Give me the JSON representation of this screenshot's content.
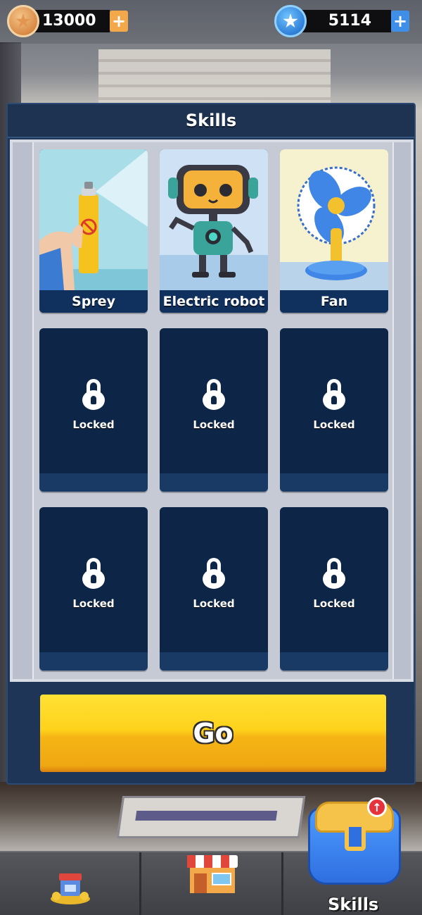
{
  "currencies": {
    "coins": {
      "icon": "coin-star-icon",
      "amount": "13000",
      "plus": "+"
    },
    "gems": {
      "icon": "blue-star-gem-icon",
      "amount": "5114",
      "plus": "+"
    }
  },
  "panel": {
    "title": "Skills",
    "skills": [
      {
        "name": "Sprey",
        "state": "unlocked",
        "art": "spray-can-icon"
      },
      {
        "name": "Electric robot",
        "state": "unlocked",
        "art": "robot-icon"
      },
      {
        "name": "Fan",
        "state": "unlocked",
        "art": "fan-icon"
      },
      {
        "label": "Locked",
        "state": "locked"
      },
      {
        "label": "Locked",
        "state": "locked"
      },
      {
        "label": "Locked",
        "state": "locked"
      },
      {
        "label": "Locked",
        "state": "locked"
      },
      {
        "label": "Locked",
        "state": "locked"
      },
      {
        "label": "Locked",
        "state": "locked"
      }
    ],
    "go_label": "Go"
  },
  "bottom_nav": {
    "tabs": [
      {
        "icon": "gift-shop-icon"
      },
      {
        "icon": "store-icon"
      },
      {
        "icon": "backpack-icon",
        "label": "Skills",
        "alert": "↑"
      }
    ]
  },
  "colors": {
    "panel_bg": "#1f3557",
    "card_bg": "#0d2648",
    "go_button": "#ffd21c",
    "coin_plus": "#f3a94a",
    "gem_plus": "#3f8fe8"
  }
}
